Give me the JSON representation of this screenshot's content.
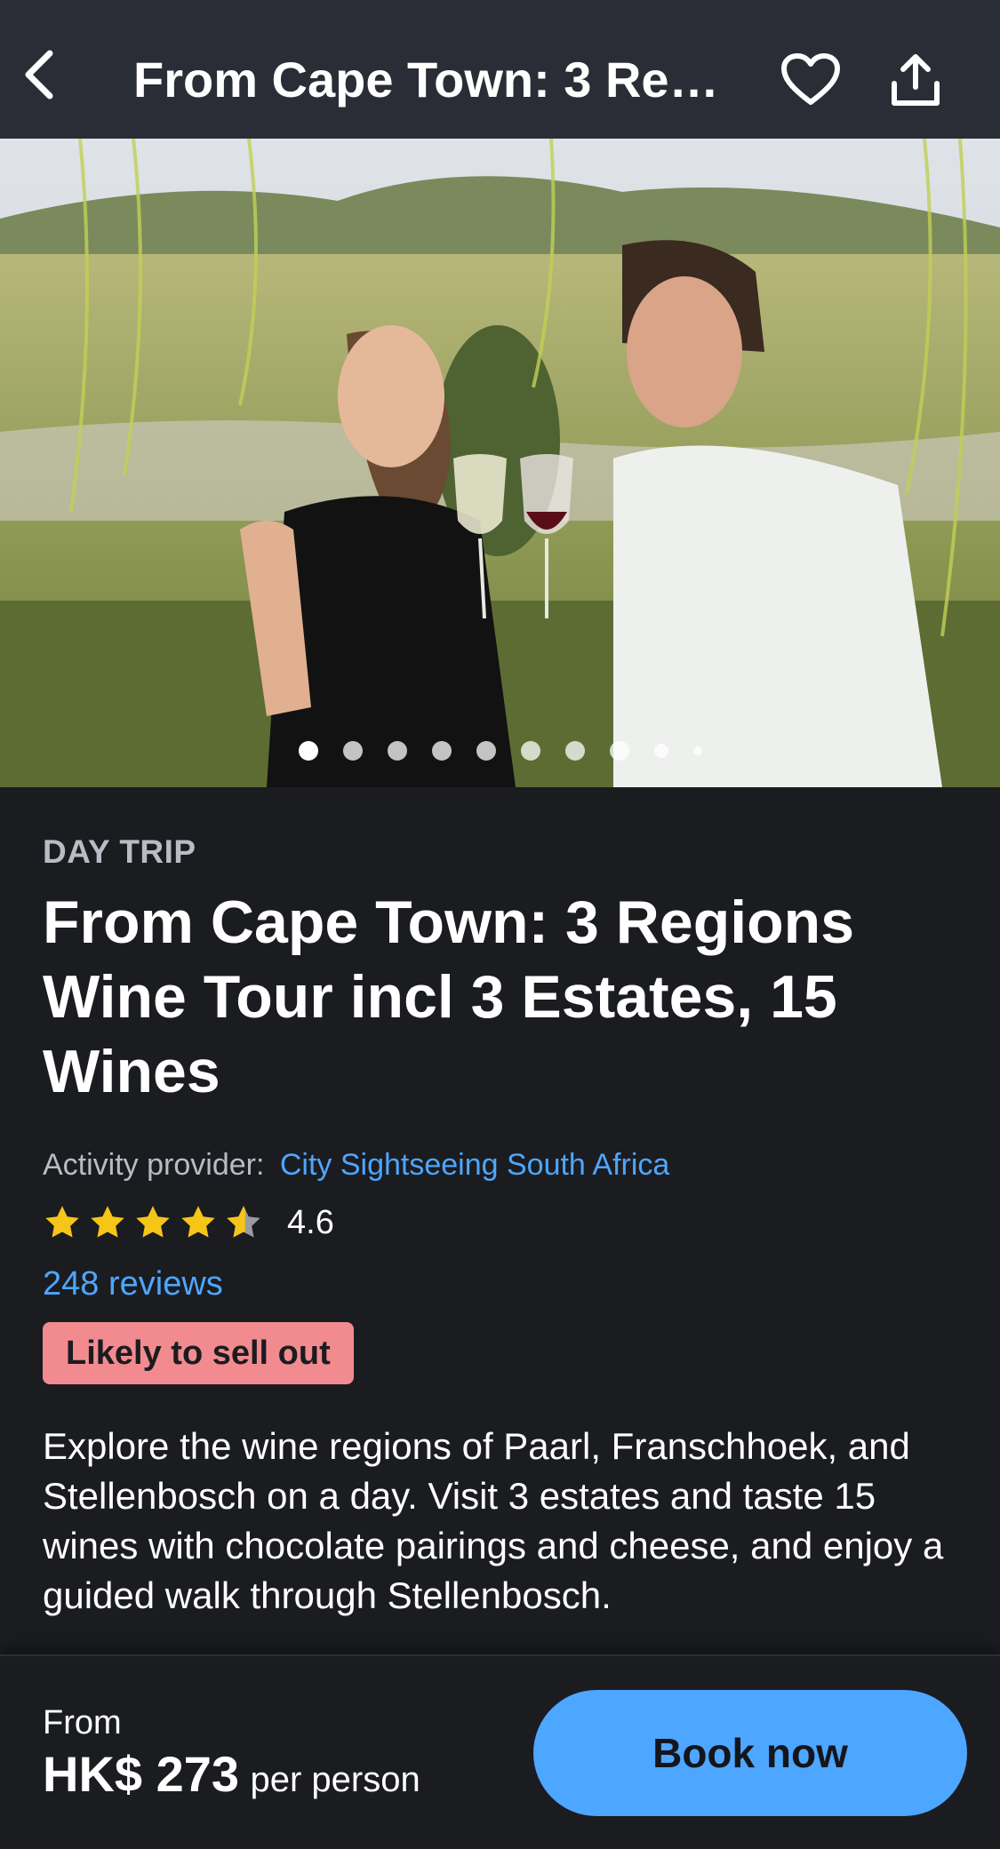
{
  "header": {
    "title": "From Cape Town: 3 Regi...",
    "back_icon": "chevron-left-icon",
    "favorite_icon": "heart-icon",
    "share_icon": "share-icon"
  },
  "gallery": {
    "image_description_icon": "photo",
    "dot_count": 10,
    "active_index": 0
  },
  "activity": {
    "category": "DAY TRIP",
    "title": "From Cape Town: 3 Regions Wine Tour incl 3 Estates, 15 Wines",
    "provider_label": "Activity provider:",
    "provider_name": "City Sightseeing South Africa",
    "rating": "4.6",
    "rating_stars": 4.6,
    "reviews": "248 reviews",
    "badge": "Likely to sell out",
    "description": "Explore the wine regions of Paarl, Franschhoek, and Stellenbosch on a day. Visit 3 estates and taste 15 wines with chocolate pairings and cheese, and enjoy a guided walk through Stellenbosch."
  },
  "footer": {
    "from_label": "From",
    "price": "HK$ 273",
    "per_person": "per person",
    "book_label": "Book now"
  },
  "colors": {
    "accent": "#4da6ff",
    "badge": "#f28b8f",
    "star": "#f5c518",
    "background": "#1b1c20",
    "header": "#2a2d36"
  }
}
